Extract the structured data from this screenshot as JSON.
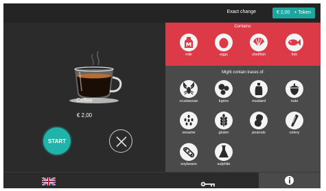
{
  "header": {
    "exact_change_label": "Exact change",
    "token_price": "€ 2,00",
    "token_label": "+ Token"
  },
  "product": {
    "name": "Coffee",
    "price": "€ 2,00"
  },
  "actions": {
    "start_label": "START"
  },
  "allergens": {
    "contains_title": "Contains:",
    "contains": [
      {
        "label": "milk",
        "icon": "milk-icon"
      },
      {
        "label": "eggs",
        "icon": "egg-icon"
      },
      {
        "label": "shellfish",
        "icon": "shellfish-icon"
      },
      {
        "label": "fish",
        "icon": "fish-icon"
      }
    ],
    "traces_title": "Might contain traces of:",
    "traces": [
      {
        "label": "crustacean",
        "icon": "crustacean-icon"
      },
      {
        "label": "lupins",
        "icon": "lupins-icon"
      },
      {
        "label": "mustard",
        "icon": "mustard-icon"
      },
      {
        "label": "nuts",
        "icon": "nuts-icon"
      },
      {
        "label": "sesame",
        "icon": "sesame-icon"
      },
      {
        "label": "gluten",
        "icon": "gluten-icon"
      },
      {
        "label": "peanuts",
        "icon": "peanuts-icon"
      },
      {
        "label": "celery",
        "icon": "celery-icon"
      },
      {
        "label": "soybeans",
        "icon": "soybeans-icon"
      },
      {
        "label": "sulphite",
        "icon": "sulphite-icon"
      }
    ]
  },
  "colors": {
    "accent_teal": "#1fb3aa",
    "contains_red": "#dd3a48",
    "traces_gray": "#4a4a4a",
    "background": "#2b2b2b"
  },
  "footer": {
    "language_icon": "uk-flag-icon",
    "service_icon": "key-icon",
    "info_icon": "info-icon"
  }
}
